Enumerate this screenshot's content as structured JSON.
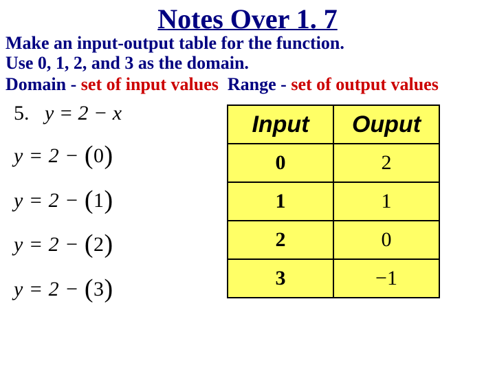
{
  "title": "Notes Over 1. 7",
  "instructions": {
    "line1": "Make an input-output table for the function.",
    "line2": "Use 0, 1, 2, and 3 as the domain."
  },
  "definitions": {
    "domain_label": "Domain",
    "domain_sep": " -  ",
    "domain_text": "set of input values",
    "range_label": "Range",
    "range_sep": " -  ",
    "range_text": "set of output values"
  },
  "problem": {
    "number": "5.",
    "equation": "y = 2 − x"
  },
  "steps": [
    {
      "lhs": "y",
      "eq": " = 2 − ",
      "arg": "0"
    },
    {
      "lhs": "y",
      "eq": " = 2 − ",
      "arg": "1"
    },
    {
      "lhs": "y",
      "eq": " = 2 − ",
      "arg": "2"
    },
    {
      "lhs": "y",
      "eq": " = 2 − ",
      "arg": "3"
    }
  ],
  "table": {
    "headers": {
      "input": "Input",
      "output": "Ouput"
    },
    "rows": [
      {
        "input": "0",
        "output": "2"
      },
      {
        "input": "1",
        "output": "1"
      },
      {
        "input": "2",
        "output": "0"
      },
      {
        "input": "3",
        "output": "−1"
      }
    ]
  },
  "chart_data": {
    "type": "table",
    "title": "Input-Output table for y = 2 − x",
    "columns": [
      "Input",
      "Ouput"
    ],
    "rows": [
      [
        0,
        2
      ],
      [
        1,
        1
      ],
      [
        2,
        0
      ],
      [
        3,
        -1
      ]
    ]
  }
}
